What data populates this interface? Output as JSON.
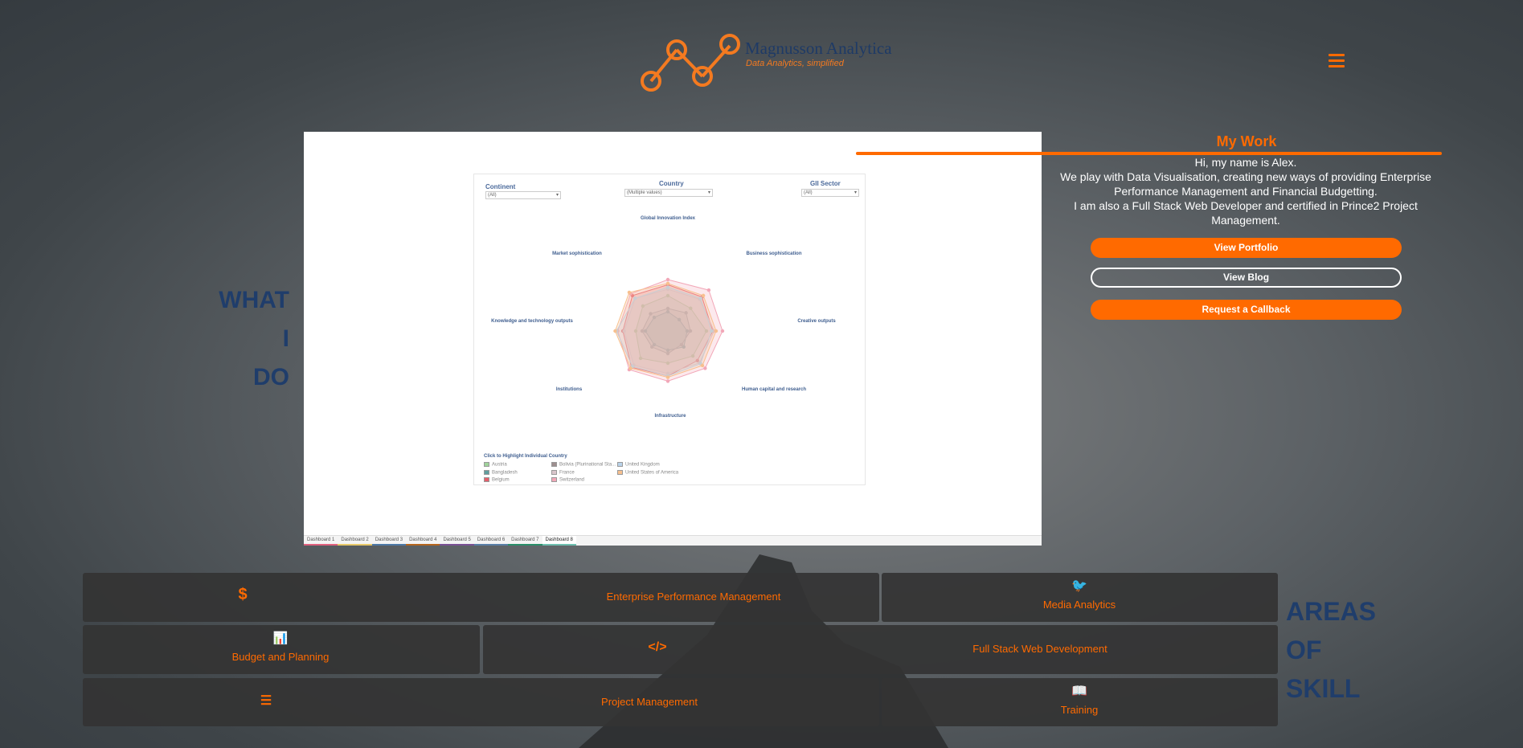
{
  "header": {
    "brand_name": "Magnusson Analytica",
    "tagline": "Data Analytics, simplified",
    "menu_icon": "hamburger-icon"
  },
  "left_heading": [
    "WHAT",
    "I",
    "DO"
  ],
  "right_heading": [
    "AREAS",
    "OF",
    "SKILL"
  ],
  "dashboard": {
    "filters": [
      {
        "label": "Continent",
        "value": "(All)"
      },
      {
        "label": "Country",
        "value": "(Multiple values)"
      },
      {
        "label": "GII Sector",
        "value": "(All)"
      }
    ],
    "legend_title": "Click to Highlight Individual Country",
    "tabs": [
      "Dashboard 1",
      "Dashboard 2",
      "Dashboard 3",
      "Dashboard 4",
      "Dashboard 5",
      "Dashboard 6",
      "Dashboard 7",
      "Dashboard 8"
    ],
    "active_tab": "Dashboard 8"
  },
  "chart_data": {
    "type": "radar",
    "axes": [
      "Global Innovation Index",
      "Business sophistication",
      "Creative outputs",
      "Human capital and research",
      "Infrastructure",
      "Institutions",
      "Knowledge and technology outputs",
      "Market sophistication"
    ],
    "series": [
      {
        "name": "Austria",
        "color": "#9fd39a"
      },
      {
        "name": "Bangladesh",
        "color": "#5f9e9e"
      },
      {
        "name": "Belgium",
        "color": "#e45f6a"
      },
      {
        "name": "Bolivia (Plurinational Sta...",
        "color": "#9e8f8f"
      },
      {
        "name": "France",
        "color": "#d9c6cc"
      },
      {
        "name": "Switzerland",
        "color": "#f2a7b8"
      },
      {
        "name": "United Kingdom",
        "color": "#b9d3ea"
      },
      {
        "name": "United States of America",
        "color": "#f7c08f"
      }
    ]
  },
  "my_work": {
    "title": "My Work",
    "lines": [
      "Hi, my name is Alex.",
      "We play with Data Visualisation, creating new ways of providing Enterprise Performance Management and Financial Budgetting.",
      "I am also a Full Stack Web Developer and certified in Prince2 Project Management."
    ],
    "buttons": {
      "portfolio": "View Portfolio",
      "blog": "View Blog",
      "callback": "Request a Callback"
    }
  },
  "skills": [
    {
      "label": "Enterprise Performance Management",
      "icon": "dollar-icon",
      "glyph": "$"
    },
    {
      "label": "Media Analytics",
      "icon": "twitter-icon",
      "glyph": "🐦"
    },
    {
      "label": "Budget and Planning",
      "icon": "bar-chart-icon",
      "glyph": "📊"
    },
    {
      "label": "Full Stack Web Development",
      "icon": "code-icon",
      "glyph": "</>"
    },
    {
      "label": "Project Management",
      "icon": "tasks-icon",
      "glyph": "☰"
    },
    {
      "label": "Training",
      "icon": "book-reader-icon",
      "glyph": "📖"
    }
  ],
  "colors": {
    "accent": "#ff6a00",
    "heading": "#1f3d6b",
    "tile": "#343434"
  }
}
